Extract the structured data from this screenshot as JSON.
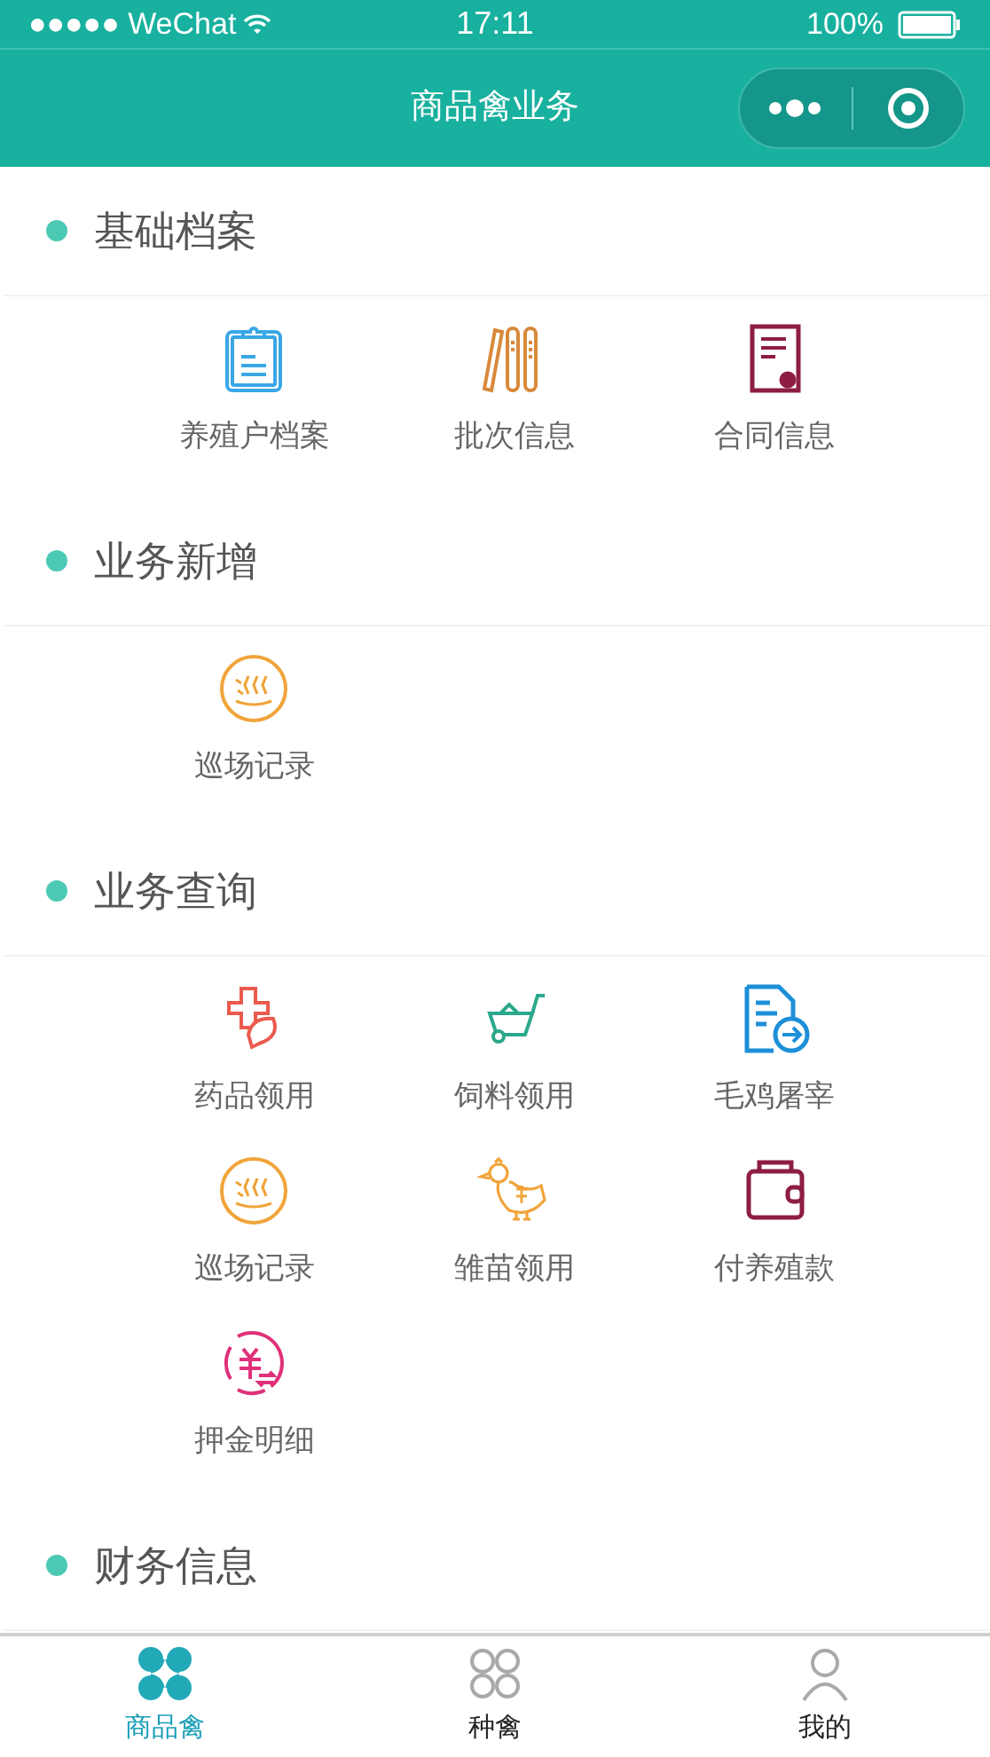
{
  "status_bar": {
    "carrier": "●●●●● WeChat",
    "time": "17:11",
    "battery": "100%"
  },
  "nav_bar": {
    "title": "商品禽业务"
  },
  "sections": [
    {
      "title": "基础档案",
      "items": [
        {
          "label": "养殖户档案",
          "kind": "clipboard"
        },
        {
          "label": "批次信息",
          "kind": "books"
        },
        {
          "label": "合同信息",
          "kind": "contract"
        }
      ]
    },
    {
      "title": "业务新增",
      "items": [
        {
          "label": "巡场记录",
          "kind": "patrol"
        }
      ]
    },
    {
      "title": "业务查询",
      "items": [
        {
          "label": "药品领用",
          "kind": "medicine"
        },
        {
          "label": "饲料领用",
          "kind": "cart"
        },
        {
          "label": "毛鸡屠宰",
          "kind": "document"
        },
        {
          "label": "巡场记录",
          "kind": "patrol"
        },
        {
          "label": "雏苗领用",
          "kind": "duck"
        },
        {
          "label": "付养殖款",
          "kind": "wallet"
        },
        {
          "label": "押金明细",
          "kind": "deposit"
        }
      ]
    },
    {
      "title": "财务信息"
    }
  ],
  "tab_bar": [
    {
      "label": "商品禽",
      "selected": true
    },
    {
      "label": "种禽",
      "selected": false
    },
    {
      "label": "我的",
      "selected": false
    }
  ]
}
